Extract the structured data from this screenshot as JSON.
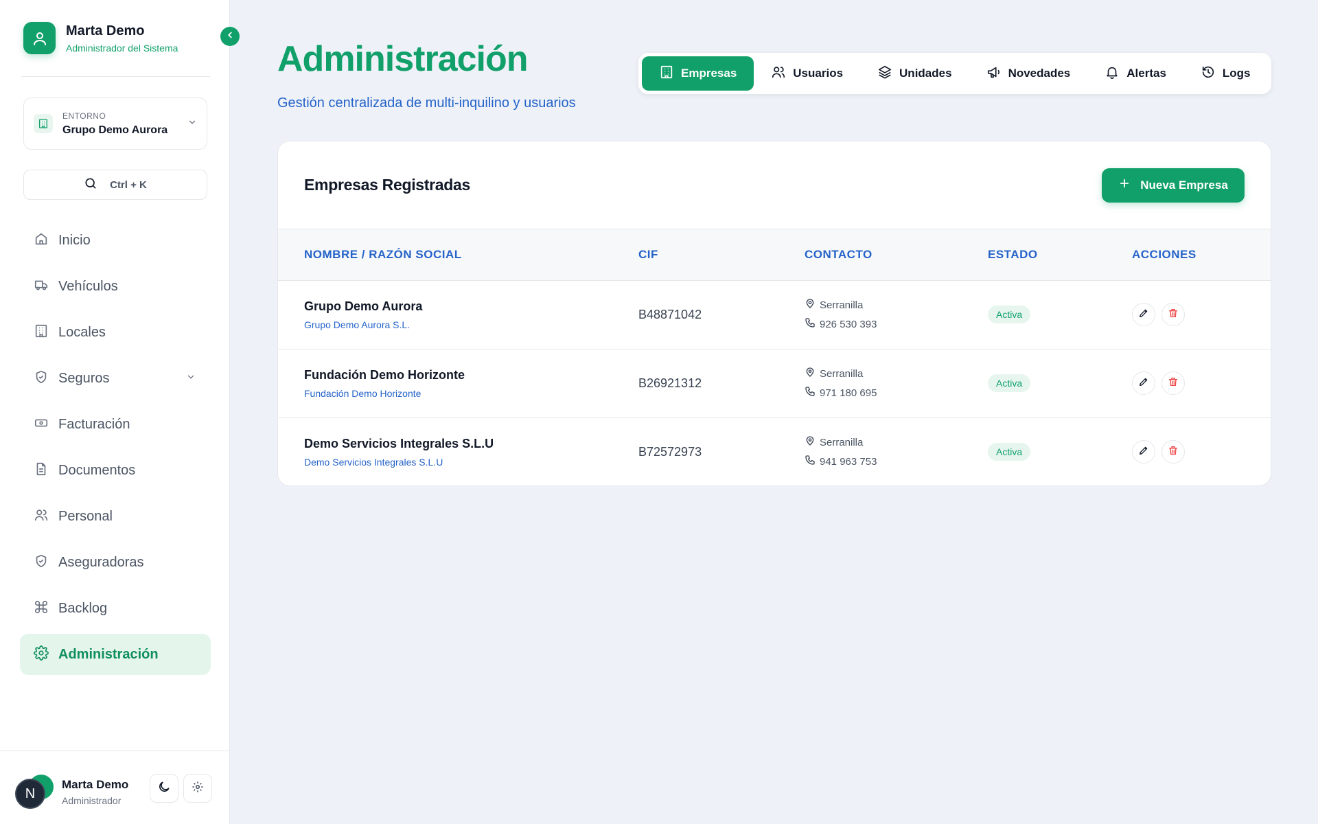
{
  "sidebar": {
    "profile": {
      "name": "Marta Demo",
      "role": "Administrador del Sistema",
      "icon": "user-icon"
    },
    "environment": {
      "label": "ENTORNO",
      "value": "Grupo Demo Aurora"
    },
    "search": {
      "hint": "Ctrl + K"
    },
    "nav": [
      {
        "label": "Inicio",
        "icon": "home-icon"
      },
      {
        "label": "Vehículos",
        "icon": "truck-icon"
      },
      {
        "label": "Locales",
        "icon": "building-icon"
      },
      {
        "label": "Seguros",
        "icon": "shield-icon"
      },
      {
        "label": "Facturación",
        "icon": "banknote-icon"
      },
      {
        "label": "Documentos",
        "icon": "document-icon"
      },
      {
        "label": "Personal",
        "icon": "users-icon"
      },
      {
        "label": "Aseguradoras",
        "icon": "shield-check-icon"
      },
      {
        "label": "Backlog",
        "icon": "command-icon"
      },
      {
        "label": "Administración",
        "icon": "gear-icon",
        "active": true
      }
    ],
    "footer": {
      "avatar_letter": "N",
      "name": "Marta Demo",
      "role": "Administrador"
    }
  },
  "header": {
    "title": "Administración",
    "subtitle": "Gestión centralizada de multi-inquilino y usuarios"
  },
  "tabs": [
    {
      "label": "Empresas",
      "icon": "building-icon",
      "active": true
    },
    {
      "label": "Usuarios",
      "icon": "users-icon"
    },
    {
      "label": "Unidades",
      "icon": "layers-icon"
    },
    {
      "label": "Novedades",
      "icon": "megaphone-icon"
    },
    {
      "label": "Alertas",
      "icon": "bell-icon"
    },
    {
      "label": "Logs",
      "icon": "history-icon"
    }
  ],
  "card": {
    "title": "Empresas Registradas",
    "new_button": "Nueva Empresa",
    "columns": [
      "NOMBRE / RAZÓN SOCIAL",
      "CIF",
      "CONTACTO",
      "ESTADO",
      "ACCIONES"
    ],
    "rows": [
      {
        "name": "Grupo Demo Aurora",
        "legal": "Grupo Demo Aurora S.L.",
        "cif": "B48871042",
        "city": "Serranilla",
        "phone": "926 530 393",
        "status": "Activa"
      },
      {
        "name": "Fundación Demo Horizonte",
        "legal": "Fundación Demo Horizonte",
        "cif": "B26921312",
        "city": "Serranilla",
        "phone": "971 180 695",
        "status": "Activa"
      },
      {
        "name": "Demo Servicios Integrales S.L.U",
        "legal": "Demo Servicios Integrales S.L.U",
        "cif": "B72572973",
        "city": "Serranilla",
        "phone": "941 963 753",
        "status": "Activa"
      }
    ]
  },
  "colors": {
    "brand": "#12a06a",
    "link": "#2563c9",
    "danger": "#ef4444"
  }
}
